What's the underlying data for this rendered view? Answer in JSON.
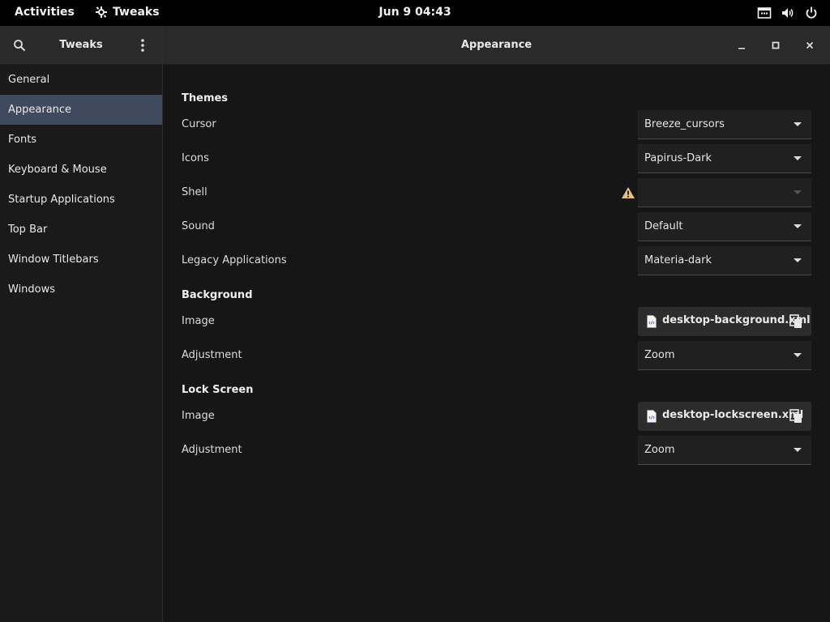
{
  "topbar": {
    "activities": "Activities",
    "app_name": "Tweaks",
    "clock": "Jun 9  04:43"
  },
  "sidebar": {
    "title": "Tweaks",
    "items": [
      {
        "label": "General"
      },
      {
        "label": "Appearance"
      },
      {
        "label": "Fonts"
      },
      {
        "label": "Keyboard & Mouse"
      },
      {
        "label": "Startup Applications"
      },
      {
        "label": "Top Bar"
      },
      {
        "label": "Window Titlebars"
      },
      {
        "label": "Windows"
      }
    ],
    "active_index": 1
  },
  "window": {
    "title": "Appearance"
  },
  "themes": {
    "title": "Themes",
    "cursor": {
      "label": "Cursor",
      "value": "Breeze_cursors"
    },
    "icons": {
      "label": "Icons",
      "value": "Papirus-Dark"
    },
    "shell": {
      "label": "Shell",
      "value": ""
    },
    "sound": {
      "label": "Sound",
      "value": "Default"
    },
    "legacy": {
      "label": "Legacy Applications",
      "value": "Materia-dark"
    }
  },
  "background": {
    "title": "Background",
    "image": {
      "label": "Image",
      "file": "desktop-background.xml"
    },
    "adjustment": {
      "label": "Adjustment",
      "value": "Zoom"
    }
  },
  "lockscreen": {
    "title": "Lock Screen",
    "image": {
      "label": "Image",
      "file": "desktop-lockscreen.xml"
    },
    "adjustment": {
      "label": "Adjustment",
      "value": "Zoom"
    }
  },
  "colors": {
    "topbar": "#000000",
    "header": "#2a2a2a",
    "sidebar": "#1a1a1a",
    "content": "#161616",
    "selection": "#3f4a5e",
    "warning": "#e5c07b"
  },
  "icons": [
    "app-icon",
    "screen-icon",
    "volume-icon",
    "power-icon",
    "search-icon",
    "menu-icon",
    "minimize-icon",
    "maximize-icon",
    "close-icon",
    "warning-icon",
    "xml-file-icon",
    "file-picker-icon",
    "chevron-down-icon"
  ]
}
